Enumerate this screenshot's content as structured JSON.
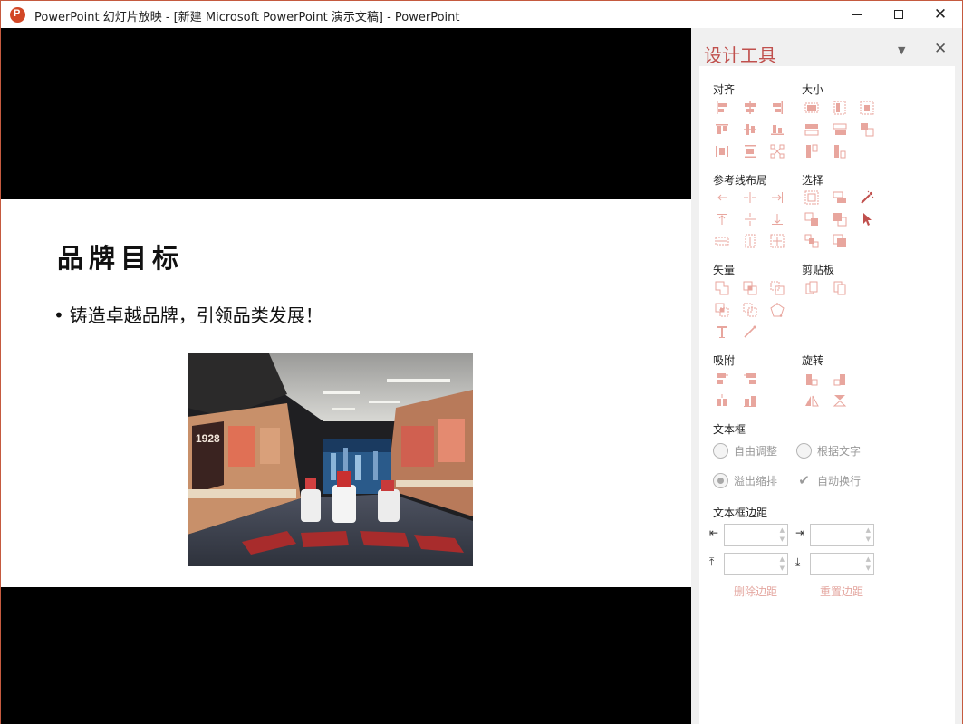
{
  "window": {
    "title": "PowerPoint 幻灯片放映 - [新建 Microsoft PowerPoint 演示文稿] - PowerPoint",
    "accent": "#c55a3f"
  },
  "slide": {
    "title": "品牌目标",
    "bullet": "铸造卓越品牌，引领品类发展！",
    "bullet_marker": "•"
  },
  "pane": {
    "title": "设计工具",
    "title_color": "#c0504d",
    "icon_color": "#e8a69e",
    "sections": {
      "align": "对齐",
      "size": "大小",
      "guides": "参考线布局",
      "select": "选择",
      "vector": "矢量",
      "clipboard": "剪贴板",
      "snap": "吸附",
      "rotate": "旋转",
      "textbox": "文本框",
      "textbox_margin": "文本框边距"
    },
    "textbox_options": {
      "free_adjust": "自由调整",
      "fit_text": "根据文字",
      "shrink_overflow": "溢出缩排",
      "auto_wrap": "自动换行"
    },
    "margin_buttons": {
      "delete": "删除边距",
      "reset": "重置边距"
    }
  }
}
